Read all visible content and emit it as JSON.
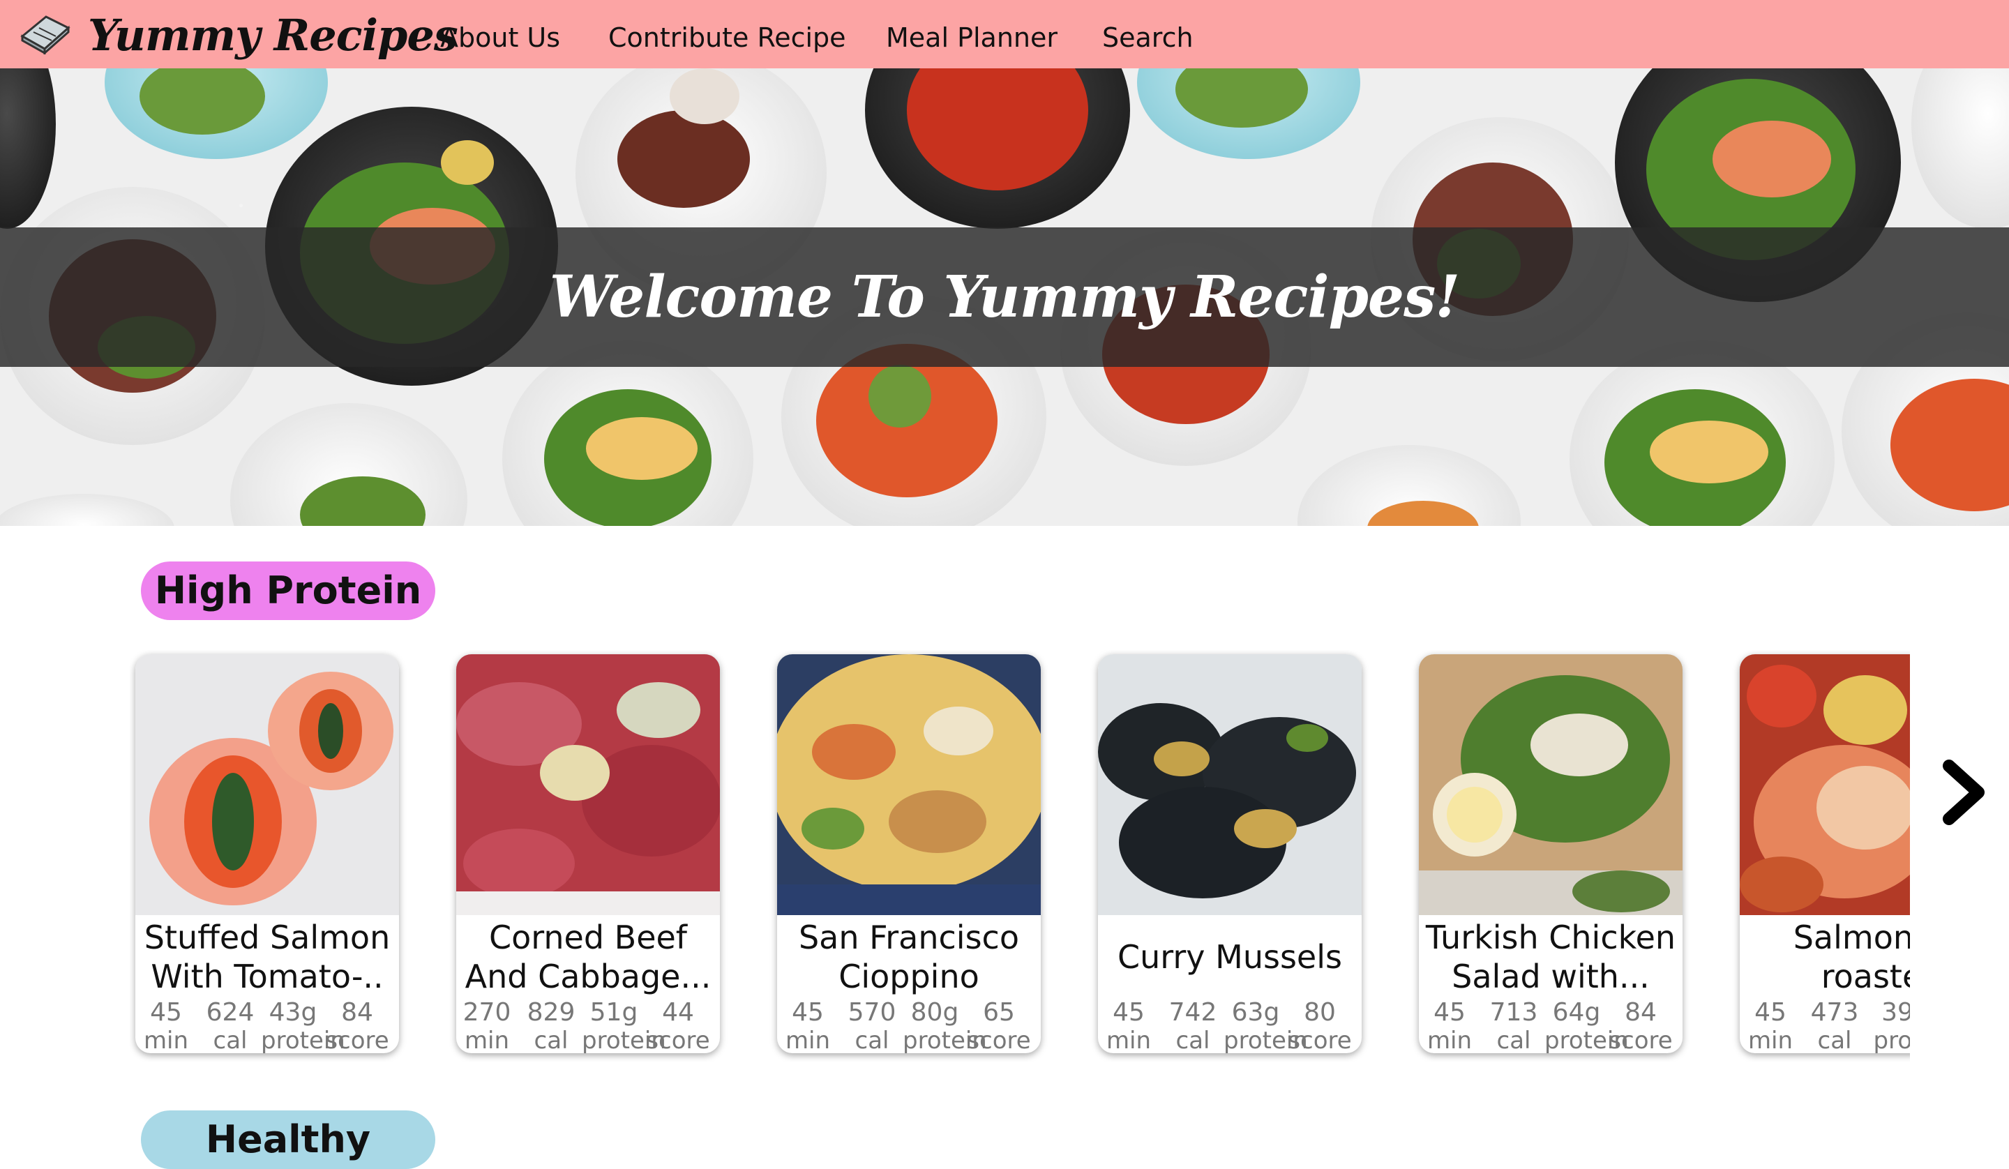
{
  "nav": {
    "logo_text": "Yummy Recipes",
    "links": [
      "About Us",
      "Contribute Recipe",
      "Meal Planner",
      "Search"
    ],
    "bg_color": "#fca4a4"
  },
  "hero": {
    "title": "Welcome To Yummy Recipes!"
  },
  "sections": [
    {
      "title": "High Protein",
      "pill_color": "#ee82ee",
      "recipes": [
        {
          "title": "Stuffed Salmon With Tomato-..",
          "time": "45",
          "time_unit": "min",
          "cal": "624",
          "cal_unit": "cal",
          "protein": "43g",
          "protein_unit": "protein",
          "score": "84",
          "score_unit": "score",
          "image": "stuffed-salmon-photo"
        },
        {
          "title": "Corned Beef And Cabbage...",
          "time": "270",
          "time_unit": "min",
          "cal": "829",
          "cal_unit": "cal",
          "protein": "51g",
          "protein_unit": "protein",
          "score": "44",
          "score_unit": "score",
          "image": "corned-beef-photo"
        },
        {
          "title": "San Francisco Cioppino",
          "time": "45",
          "time_unit": "min",
          "cal": "570",
          "cal_unit": "cal",
          "protein": "80g",
          "protein_unit": "protein",
          "score": "65",
          "score_unit": "score",
          "image": "cioppino-photo"
        },
        {
          "title": "Curry Mussels",
          "time": "45",
          "time_unit": "min",
          "cal": "742",
          "cal_unit": "cal",
          "protein": "63g",
          "protein_unit": "protein",
          "score": "80",
          "score_unit": "score",
          "image": "mussels-photo"
        },
        {
          "title": "Turkish Chicken Salad with...",
          "time": "45",
          "time_unit": "min",
          "cal": "713",
          "cal_unit": "cal",
          "protein": "64g",
          "protein_unit": "protein",
          "score": "84",
          "score_unit": "score",
          "image": "chicken-salad-photo"
        },
        {
          "title": "Salmon w roaste",
          "time": "45",
          "time_unit": "min",
          "cal": "473",
          "cal_unit": "cal",
          "protein": "39",
          "protein_unit": "prot",
          "score": "",
          "score_unit": "",
          "image": "salmon-roasted-photo"
        }
      ]
    },
    {
      "title": "Healthy",
      "pill_color": "#a8d8e6"
    }
  ],
  "icons": {
    "logo": "recipe-book-icon",
    "next": "chevron-right-icon"
  }
}
